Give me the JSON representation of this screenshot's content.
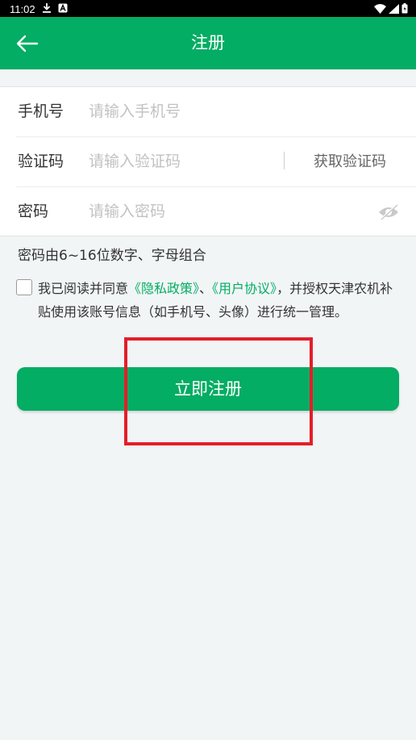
{
  "status_bar": {
    "time": "11:02",
    "icons": [
      "download-icon",
      "notification-a-icon",
      "wifi-icon",
      "signal-icon",
      "battery-icon"
    ]
  },
  "header": {
    "title": "注册",
    "back_icon": "back-arrow-icon",
    "color": "#03ad63"
  },
  "form": {
    "phone": {
      "label": "手机号",
      "placeholder": "请输入手机号",
      "value": ""
    },
    "code": {
      "label": "验证码",
      "placeholder": "请输入验证码",
      "value": "",
      "action_label": "获取验证码"
    },
    "password": {
      "label": "密码",
      "placeholder": "请输入密码",
      "value": "",
      "toggle_icon": "eye-hidden-icon"
    }
  },
  "hint": "密码由6~16位数字、字母组合",
  "agreement": {
    "checked": false,
    "prefix": "我已阅读并同意",
    "privacy_link": "《隐私政策》",
    "separator": "、",
    "user_link": "《用户协议》",
    "suffix": "，并授权天津农机补贴使用该账号信息（如手机号、头像）进行统一管理。"
  },
  "register_button": "立即注册",
  "annotation": {
    "type": "red-highlight-box",
    "color": "#e31e2a"
  }
}
